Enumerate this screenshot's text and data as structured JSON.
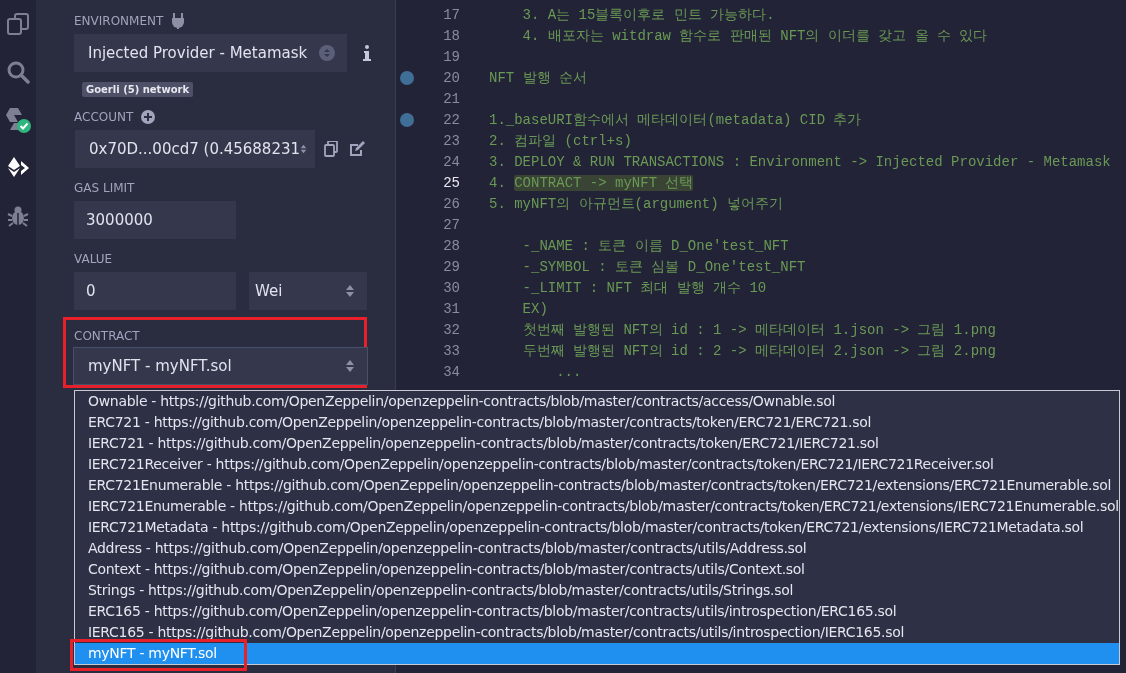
{
  "activity_bar": [
    {
      "kind": "files",
      "selected": false
    },
    {
      "kind": "search",
      "selected": false
    },
    {
      "kind": "compiler",
      "selected": false,
      "badge": true
    },
    {
      "kind": "deploy",
      "selected": true
    },
    {
      "kind": "debugger",
      "selected": false
    }
  ],
  "run_panel": {
    "environment": {
      "label": "ENVIRONMENT",
      "value": "Injected Provider - Metamask",
      "network": "Goerli (5) network"
    },
    "account": {
      "label": "ACCOUNT",
      "value": "0x70D...00cd7 (0.45688231"
    },
    "gas_limit": {
      "label": "GAS LIMIT",
      "value": "3000000"
    },
    "value": {
      "label": "VALUE",
      "amount": "0",
      "unit": "Wei"
    },
    "contract": {
      "label": "CONTRACT",
      "value": "myNFT - myNFT.sol",
      "highlighted": true
    }
  },
  "editor": {
    "lines": [
      {
        "number": "17",
        "text": "    3. A는 15블록이후로 민트 가능하다.",
        "breakpoint": false,
        "current": false
      },
      {
        "number": "18",
        "text": "    4. 배포자는 witdraw 함수로 판매된 NFT의 이더를 갖고 올 수 있다",
        "breakpoint": false,
        "current": false
      },
      {
        "number": "19",
        "breakpoint": false,
        "current": false
      },
      {
        "number": "20",
        "text": "NFT 발행 순서",
        "breakpoint": true,
        "current": false
      },
      {
        "number": "21",
        "breakpoint": false,
        "current": false
      },
      {
        "number": "22",
        "text": "1._baseURI함수에서 메타데이터(metadata) CID 추가",
        "breakpoint": true,
        "current": false
      },
      {
        "number": "23",
        "text": "2. 컴파일 (ctrl+s)",
        "breakpoint": false,
        "current": false
      },
      {
        "number": "24",
        "text": "3. DEPLOY & RUN TRANSACTIONS : Environment -> Injected Provider - Metamask",
        "breakpoint": false,
        "current": false
      },
      {
        "number": "25",
        "text": "4. ",
        "selection": "CONTRACT -> myNFT 선택",
        "breakpoint": false,
        "current": true
      },
      {
        "number": "26",
        "text": "5. myNFT의 아규먼트(argument) 넣어주기",
        "breakpoint": false,
        "current": false
      },
      {
        "number": "27",
        "breakpoint": false,
        "current": false
      },
      {
        "number": "28",
        "text": "    -_NAME : 토큰 이름 D_One'test_NFT",
        "breakpoint": false,
        "current": false
      },
      {
        "number": "29",
        "text": "    -_SYMBOL : 토큰 심볼 D_One'test_NFT",
        "breakpoint": false,
        "current": false
      },
      {
        "number": "30",
        "text": "    -_LIMIT : NFT 최대 발행 개수 10",
        "breakpoint": false,
        "current": false
      },
      {
        "number": "31",
        "text": "    EX)",
        "breakpoint": false,
        "current": false
      },
      {
        "number": "32",
        "text": "    첫번째 발행된 NFT의 id : 1 -> 메타데이터 1.json -> 그림 1.png",
        "breakpoint": false,
        "current": false
      },
      {
        "number": "33",
        "text": "    두번째 발행된 NFT의 id : 2 -> 메타데이터 2.json -> 그림 2.png",
        "breakpoint": false,
        "current": false
      },
      {
        "number": "34",
        "text": "        ...",
        "breakpoint": false,
        "current": false
      }
    ]
  },
  "contract_dropdown": {
    "options": [
      {
        "label": "Ownable - https://github.com/OpenZeppelin/openzeppelin-contracts/blob/master/contracts/access/Ownable.sol",
        "selected": false
      },
      {
        "label": "ERC721 - https://github.com/OpenZeppelin/openzeppelin-contracts/blob/master/contracts/token/ERC721/ERC721.sol",
        "selected": false
      },
      {
        "label": "IERC721 - https://github.com/OpenZeppelin/openzeppelin-contracts/blob/master/contracts/token/ERC721/IERC721.sol",
        "selected": false
      },
      {
        "label": "IERC721Receiver - https://github.com/OpenZeppelin/openzeppelin-contracts/blob/master/contracts/token/ERC721/IERC721Receiver.sol",
        "selected": false
      },
      {
        "label": "ERC721Enumerable - https://github.com/OpenZeppelin/openzeppelin-contracts/blob/master/contracts/token/ERC721/extensions/ERC721Enumerable.sol",
        "selected": false
      },
      {
        "label": "IERC721Enumerable - https://github.com/OpenZeppelin/openzeppelin-contracts/blob/master/contracts/token/ERC721/extensions/IERC721Enumerable.sol",
        "selected": false
      },
      {
        "label": "IERC721Metadata - https://github.com/OpenZeppelin/openzeppelin-contracts/blob/master/contracts/token/ERC721/extensions/IERC721Metadata.sol",
        "selected": false
      },
      {
        "label": "Address - https://github.com/OpenZeppelin/openzeppelin-contracts/blob/master/contracts/utils/Address.sol",
        "selected": false
      },
      {
        "label": "Context - https://github.com/OpenZeppelin/openzeppelin-contracts/blob/master/contracts/utils/Context.sol",
        "selected": false
      },
      {
        "label": "Strings - https://github.com/OpenZeppelin/openzeppelin-contracts/blob/master/contracts/utils/Strings.sol",
        "selected": false
      },
      {
        "label": "ERC165 - https://github.com/OpenZeppelin/openzeppelin-contracts/blob/master/contracts/utils/introspection/ERC165.sol",
        "selected": false
      },
      {
        "label": "IERC165 - https://github.com/OpenZeppelin/openzeppelin-contracts/blob/master/contracts/utils/introspection/IERC165.sol",
        "selected": false
      },
      {
        "label": "myNFT - myNFT.sol",
        "selected": true,
        "highlighted": true
      }
    ]
  }
}
